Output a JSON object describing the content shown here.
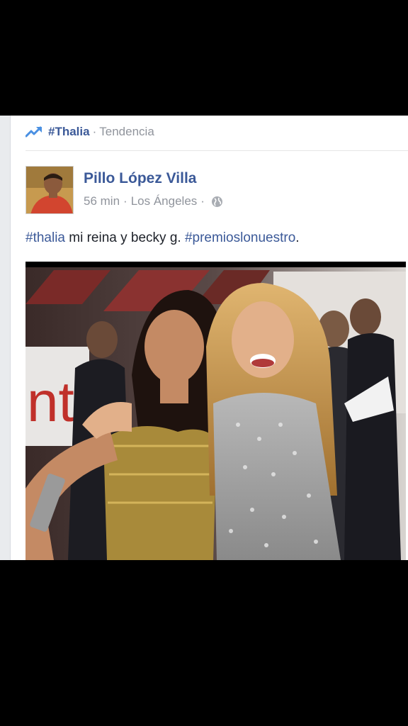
{
  "trending": {
    "icon": "trending-icon",
    "hashtag": "#Thalia",
    "separator": "·",
    "label": "Tendencia"
  },
  "post": {
    "author": "Pillo López Villa",
    "avatar_icon": "avatar",
    "time": "56 min",
    "separator": "·",
    "location": "Los Ángeles",
    "privacy_icon": "globe-icon",
    "text_parts": {
      "hashtag1": "#thalia",
      "middle": " mi reina y becky g. ",
      "hashtag2": "#premioslonuestro",
      "end": "."
    },
    "photo_icon": "post-photo"
  },
  "colors": {
    "link": "#3b5998",
    "meta": "#90949c",
    "text": "#1d2129",
    "background": "#000000"
  }
}
